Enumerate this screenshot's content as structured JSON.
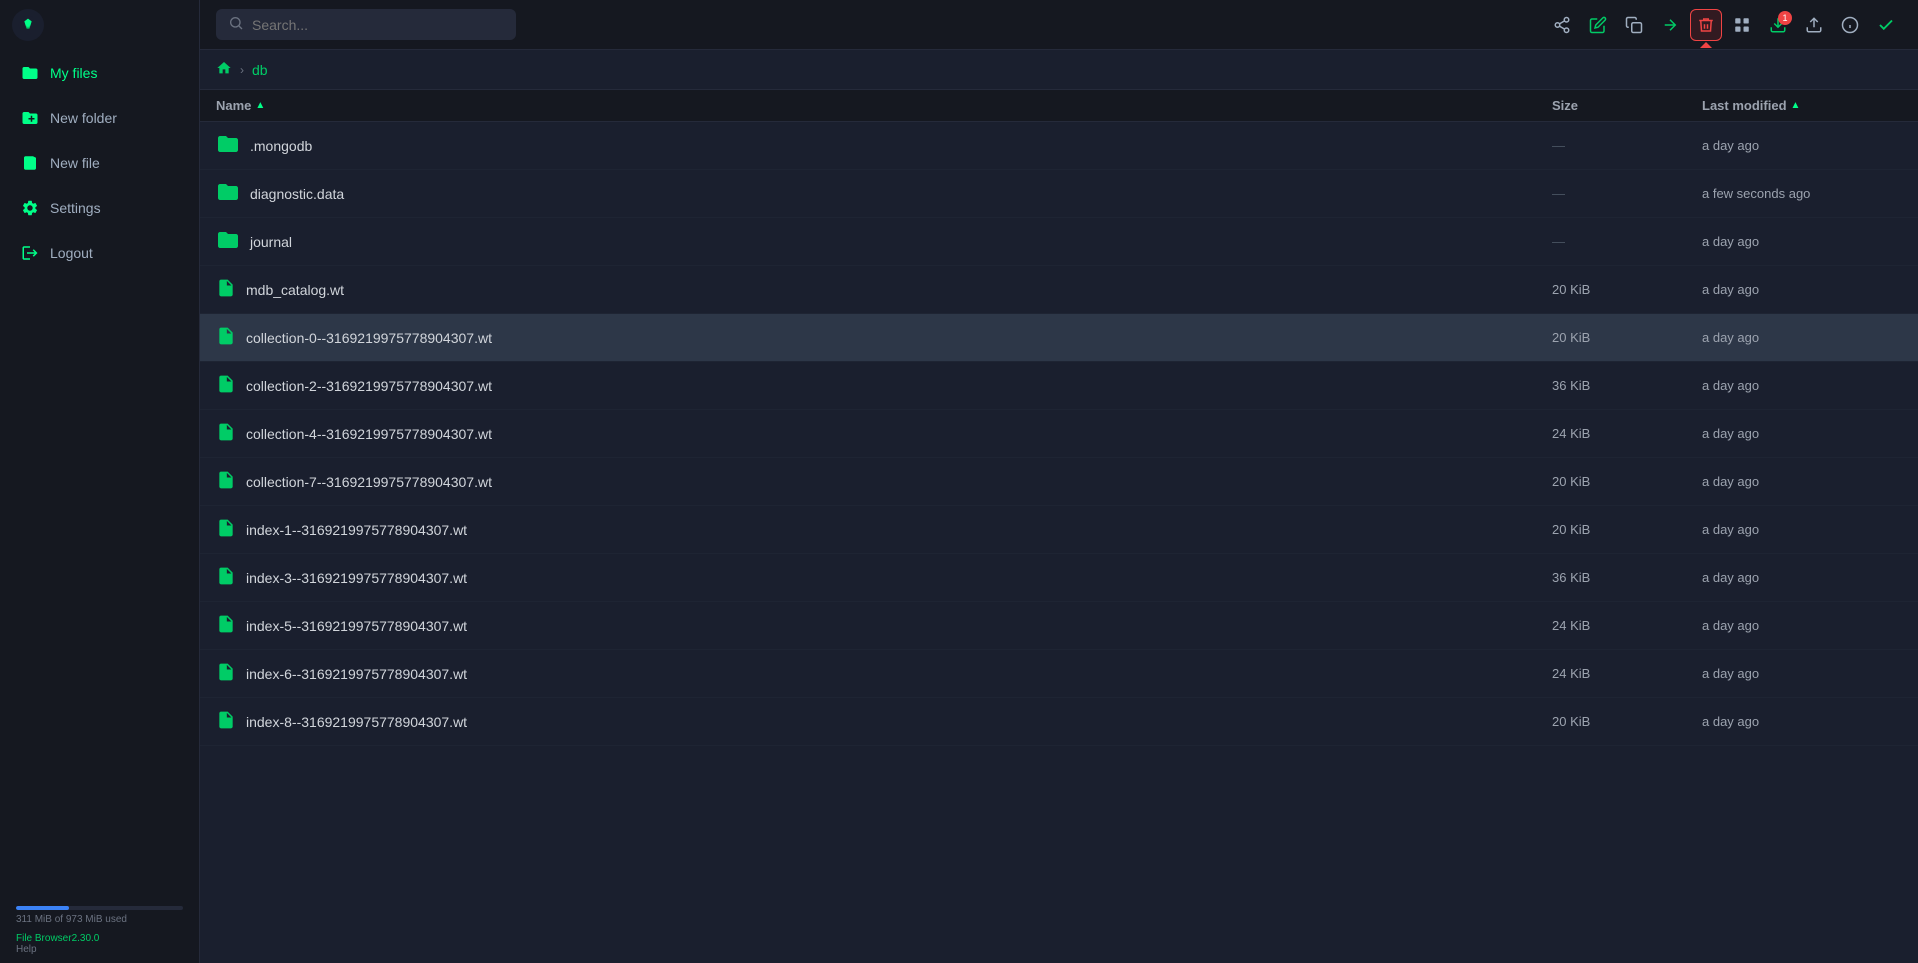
{
  "app": {
    "title": "File Browser"
  },
  "header": {
    "search_placeholder": "Search...",
    "toolbar_buttons": [
      {
        "name": "share-button",
        "icon": "share",
        "label": "Share",
        "active": false
      },
      {
        "name": "edit-button",
        "icon": "edit",
        "label": "Edit",
        "active": false
      },
      {
        "name": "copy-button",
        "icon": "copy",
        "label": "Copy",
        "active": false
      },
      {
        "name": "move-button",
        "icon": "move",
        "label": "Move",
        "active": false
      },
      {
        "name": "delete-button",
        "icon": "delete",
        "label": "Delete",
        "active": true,
        "active_class": "active-red"
      },
      {
        "name": "grid-button",
        "icon": "grid",
        "label": "Grid View",
        "active": false
      },
      {
        "name": "download-button",
        "icon": "download",
        "label": "Download",
        "badge": "1",
        "active": false
      },
      {
        "name": "upload-button",
        "icon": "upload",
        "label": "Upload",
        "active": false
      },
      {
        "name": "info-button",
        "icon": "info",
        "label": "Info",
        "active": false
      },
      {
        "name": "check-button",
        "icon": "check",
        "label": "Check",
        "active": false
      }
    ]
  },
  "breadcrumb": {
    "home_title": "Home",
    "separator": "›",
    "current": "db"
  },
  "sidebar": {
    "items": [
      {
        "name": "my-files",
        "label": "My files",
        "icon": "folder"
      },
      {
        "name": "new-folder",
        "label": "New folder",
        "icon": "folder-plus"
      },
      {
        "name": "new-file",
        "label": "New file",
        "icon": "file-plus"
      },
      {
        "name": "settings",
        "label": "Settings",
        "icon": "settings"
      },
      {
        "name": "logout",
        "label": "Logout",
        "icon": "logout"
      }
    ],
    "storage": {
      "used": "311 MiB",
      "total": "973 MiB",
      "label": "311 MiB of 973 MiB used",
      "percent": 32
    },
    "version_label": "File Browser2.30.0",
    "help_label": "Help"
  },
  "table": {
    "columns": [
      {
        "key": "name",
        "label": "Name",
        "sortable": true,
        "sorted": true,
        "direction": "asc"
      },
      {
        "key": "size",
        "label": "Size",
        "sortable": false
      },
      {
        "key": "modified",
        "label": "Last modified",
        "sortable": true,
        "sorted": false,
        "direction": "asc"
      }
    ],
    "rows": [
      {
        "type": "folder",
        "name": ".mongodb",
        "size": "—",
        "modified": "a day ago",
        "selected": false
      },
      {
        "type": "folder",
        "name": "diagnostic.data",
        "size": "—",
        "modified": "a few seconds ago",
        "selected": false
      },
      {
        "type": "folder",
        "name": "journal",
        "size": "—",
        "modified": "a day ago",
        "selected": false
      },
      {
        "type": "file",
        "name": "mdb_catalog.wt",
        "size": "20 KiB",
        "modified": "a day ago",
        "selected": false
      },
      {
        "type": "file",
        "name": "collection-0--3169219975778904307.wt",
        "size": "20 KiB",
        "modified": "a day ago",
        "selected": true
      },
      {
        "type": "file",
        "name": "collection-2--3169219975778904307.wt",
        "size": "36 KiB",
        "modified": "a day ago",
        "selected": false
      },
      {
        "type": "file",
        "name": "collection-4--3169219975778904307.wt",
        "size": "24 KiB",
        "modified": "a day ago",
        "selected": false
      },
      {
        "type": "file",
        "name": "collection-7--3169219975778904307.wt",
        "size": "20 KiB",
        "modified": "a day ago",
        "selected": false
      },
      {
        "type": "file",
        "name": "index-1--3169219975778904307.wt",
        "size": "20 KiB",
        "modified": "a day ago",
        "selected": false
      },
      {
        "type": "file",
        "name": "index-3--3169219975778904307.wt",
        "size": "36 KiB",
        "modified": "a day ago",
        "selected": false
      },
      {
        "type": "file",
        "name": "index-5--3169219975778904307.wt",
        "size": "24 KiB",
        "modified": "a day ago",
        "selected": false
      },
      {
        "type": "file",
        "name": "index-6--3169219975778904307.wt",
        "size": "24 KiB",
        "modified": "a day ago",
        "selected": false
      },
      {
        "type": "file",
        "name": "index-8--3169219975778904307.wt",
        "size": "20 KiB",
        "modified": "a day ago",
        "selected": false
      }
    ]
  },
  "colors": {
    "accent": "#00ff88",
    "accent_dim": "#00cc66",
    "danger": "#ef4444",
    "bg_dark": "#151820",
    "bg_main": "#1a1f2e",
    "bg_hover": "#252a3a",
    "bg_selected": "#2d3748",
    "text_dim": "#9ca3af",
    "text_main": "#d1d5db"
  }
}
